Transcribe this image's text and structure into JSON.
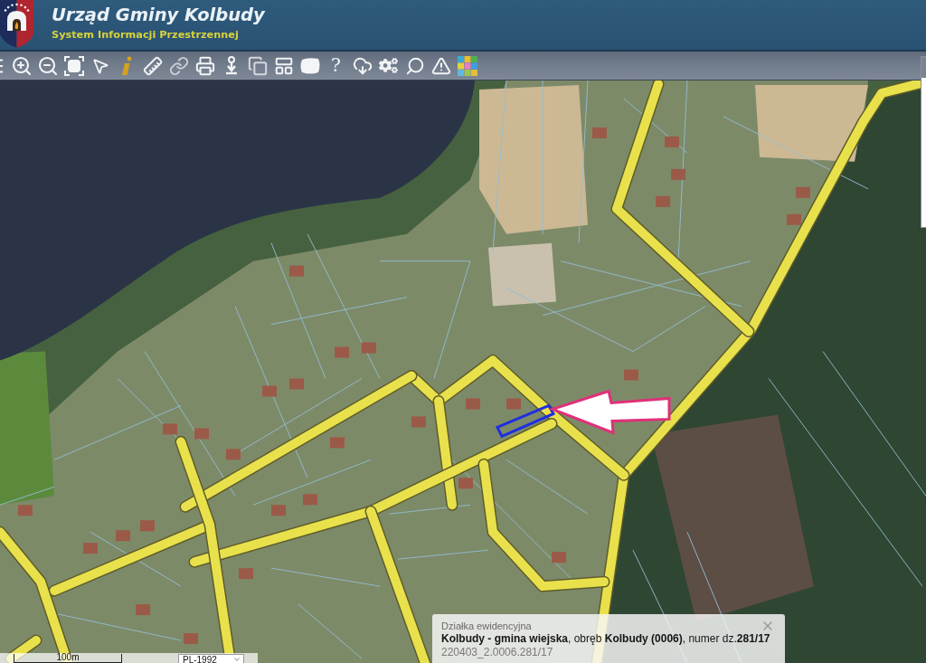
{
  "header": {
    "title": "Urząd Gminy Kolbudy",
    "subtitle": "System Informacji Przestrzennej"
  },
  "toolbar": {
    "help_symbol": "?"
  },
  "map": {
    "scale_label": "100m",
    "projection": "PL-1992"
  },
  "popup": {
    "title": "Działka ewidencyjna",
    "description": "**Kolbudy - gmina wiejska**, obręb **Kolbudy (0006)**, numer dz.**281/17**",
    "identifier": "220403_2.0006.281/17"
  }
}
